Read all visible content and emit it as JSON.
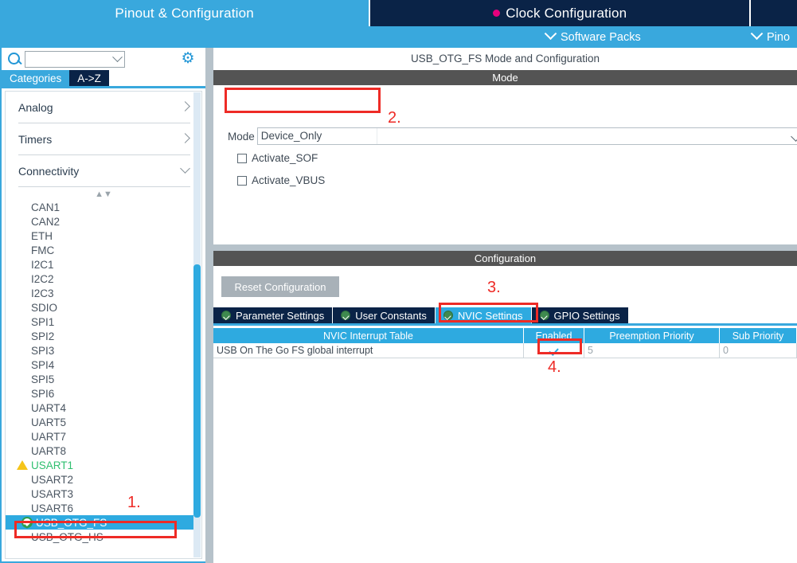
{
  "top_tabs": [
    {
      "label": "Pinout & Configuration",
      "state": "inactive"
    },
    {
      "label": "Clock Configuration",
      "state": "active",
      "dot_color": "#e8007d"
    },
    {
      "label": "Pino",
      "state": "inactive"
    }
  ],
  "secondbar": {
    "software_packs": "Software Packs",
    "pinout": "Pino"
  },
  "sidebar": {
    "search_value": "",
    "search_placeholder": "",
    "tabs": [
      {
        "label": "Categories",
        "selected": true
      },
      {
        "label": "A->Z",
        "selected": false
      }
    ],
    "groups": [
      {
        "label": "Analog",
        "expanded": false
      },
      {
        "label": "Timers",
        "expanded": false
      },
      {
        "label": "Connectivity",
        "expanded": true
      }
    ],
    "peripherals": [
      {
        "label": "CAN1",
        "status": "none"
      },
      {
        "label": "CAN2",
        "status": "none"
      },
      {
        "label": "ETH",
        "status": "none"
      },
      {
        "label": "FMC",
        "status": "none"
      },
      {
        "label": "I2C1",
        "status": "none"
      },
      {
        "label": "I2C2",
        "status": "none"
      },
      {
        "label": "I2C3",
        "status": "none"
      },
      {
        "label": "SDIO",
        "status": "none"
      },
      {
        "label": "SPI1",
        "status": "none"
      },
      {
        "label": "SPI2",
        "status": "none"
      },
      {
        "label": "SPI3",
        "status": "none"
      },
      {
        "label": "SPI4",
        "status": "none"
      },
      {
        "label": "SPI5",
        "status": "none"
      },
      {
        "label": "SPI6",
        "status": "none"
      },
      {
        "label": "UART4",
        "status": "none"
      },
      {
        "label": "UART5",
        "status": "none"
      },
      {
        "label": "UART7",
        "status": "none"
      },
      {
        "label": "UART8",
        "status": "none"
      },
      {
        "label": "USART1",
        "status": "warning"
      },
      {
        "label": "USART2",
        "status": "none"
      },
      {
        "label": "USART3",
        "status": "none"
      },
      {
        "label": "USART6",
        "status": "none"
      },
      {
        "label": "USB_OTG_FS",
        "status": "configured",
        "selected": true
      },
      {
        "label": "USB_OTG_HS",
        "status": "none"
      }
    ]
  },
  "right_pane": {
    "title": "USB_OTG_FS Mode and Configuration",
    "mode_section": {
      "header": "Mode",
      "mode_label": "Mode",
      "mode_value": "Device_Only",
      "checkboxes": [
        {
          "label": "Activate_SOF",
          "checked": false
        },
        {
          "label": "Activate_VBUS",
          "checked": false
        }
      ]
    },
    "configuration_section": {
      "header": "Configuration",
      "reset_button": "Reset Configuration",
      "tabs": [
        {
          "label": "Parameter Settings",
          "active": false
        },
        {
          "label": "User Constants",
          "active": false
        },
        {
          "label": "NVIC Settings",
          "active": true
        },
        {
          "label": "GPIO Settings",
          "active": false
        }
      ],
      "nvic_table": {
        "columns": [
          "NVIC Interrupt Table",
          "Enabled",
          "Preemption Priority",
          "Sub Priority"
        ],
        "rows": [
          {
            "interrupt": "USB On The Go FS global interrupt",
            "enabled": true,
            "preemption_priority": "5",
            "sub_priority": "0"
          }
        ]
      }
    }
  },
  "annotations": [
    {
      "number": "1."
    },
    {
      "number": "2."
    },
    {
      "number": "3."
    },
    {
      "number": "4."
    }
  ],
  "colors": {
    "accent_light_blue": "#39a8dd",
    "accent_dark_navy": "#0a2347",
    "annotation_red": "#ee2b26",
    "section_header_grey": "#545454",
    "selection_blue": "#2eaae0",
    "ok_green": "#2f9e4f",
    "warning_yellow": "#f5c419"
  }
}
